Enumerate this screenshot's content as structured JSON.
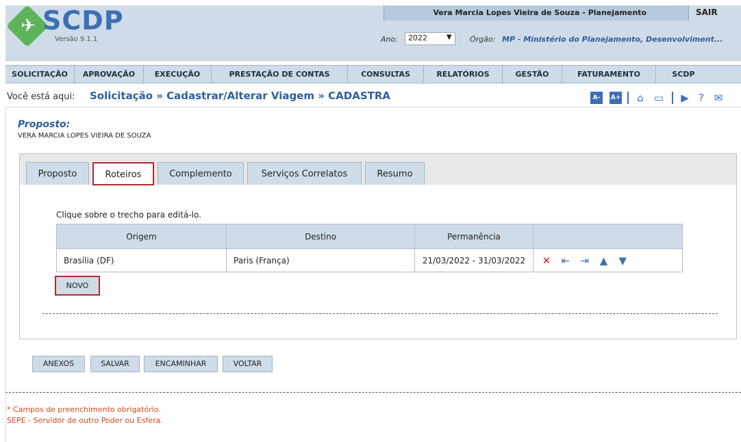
{
  "header": {
    "logo_text": "SCDP",
    "version": "Versão 9.1.1",
    "user": "Vera Marcia Lopes Vieira de Souza - Planejamento",
    "logout": "SAIR",
    "ano_label": "Ano:",
    "ano_value": "2022",
    "orgao_label": "Órgão:",
    "orgao_value": "MP - Ministério do Planejamento, Desenvolviment..."
  },
  "menu": [
    "SOLICITAÇÃO",
    "APROVAÇÃO",
    "EXECUÇÃO",
    "PRESTAÇÃO DE CONTAS",
    "CONSULTAS",
    "RELATÓRIOS",
    "GESTÃO",
    "FATURAMENTO",
    "SCDP"
  ],
  "breadcrumb": {
    "prefix": "Você está aqui:",
    "path": "Solicitação » Cadastrar/Alterar Viagem » CADASTRA"
  },
  "toolbar": {
    "font_decrease": "A-",
    "font_increase": "A+"
  },
  "proposto": {
    "label": "Proposto:",
    "name": "VERA MARCIA LOPES VIEIRA DE SOUZA"
  },
  "tabs": [
    "Proposto",
    "Roteiros",
    "Complemento",
    "Serviços Correlatos",
    "Resumo"
  ],
  "active_tab": "Roteiros",
  "roteiros": {
    "hint": "Clique sobre o trecho para editá-lo.",
    "columns": [
      "Origem",
      "Destino",
      "Permanência",
      ""
    ],
    "rows": [
      {
        "origem": "Brasília (DF)",
        "destino": "Paris (França)",
        "permanencia": "21/03/2022 - 31/03/2022"
      }
    ],
    "novo": "NOVO"
  },
  "actions": [
    "ANEXOS",
    "SALVAR",
    "ENCAMINHAR",
    "VOLTAR"
  ],
  "notes": [
    "* Campos de preenchimento obrigatório.",
    "SEPE - Servidor de outro Poder ou Esfera."
  ],
  "colors": {
    "accent": "#2d5f9e",
    "highlight": "#b22a2a",
    "delete": "#d21e1e",
    "note": "#d04a1a"
  }
}
